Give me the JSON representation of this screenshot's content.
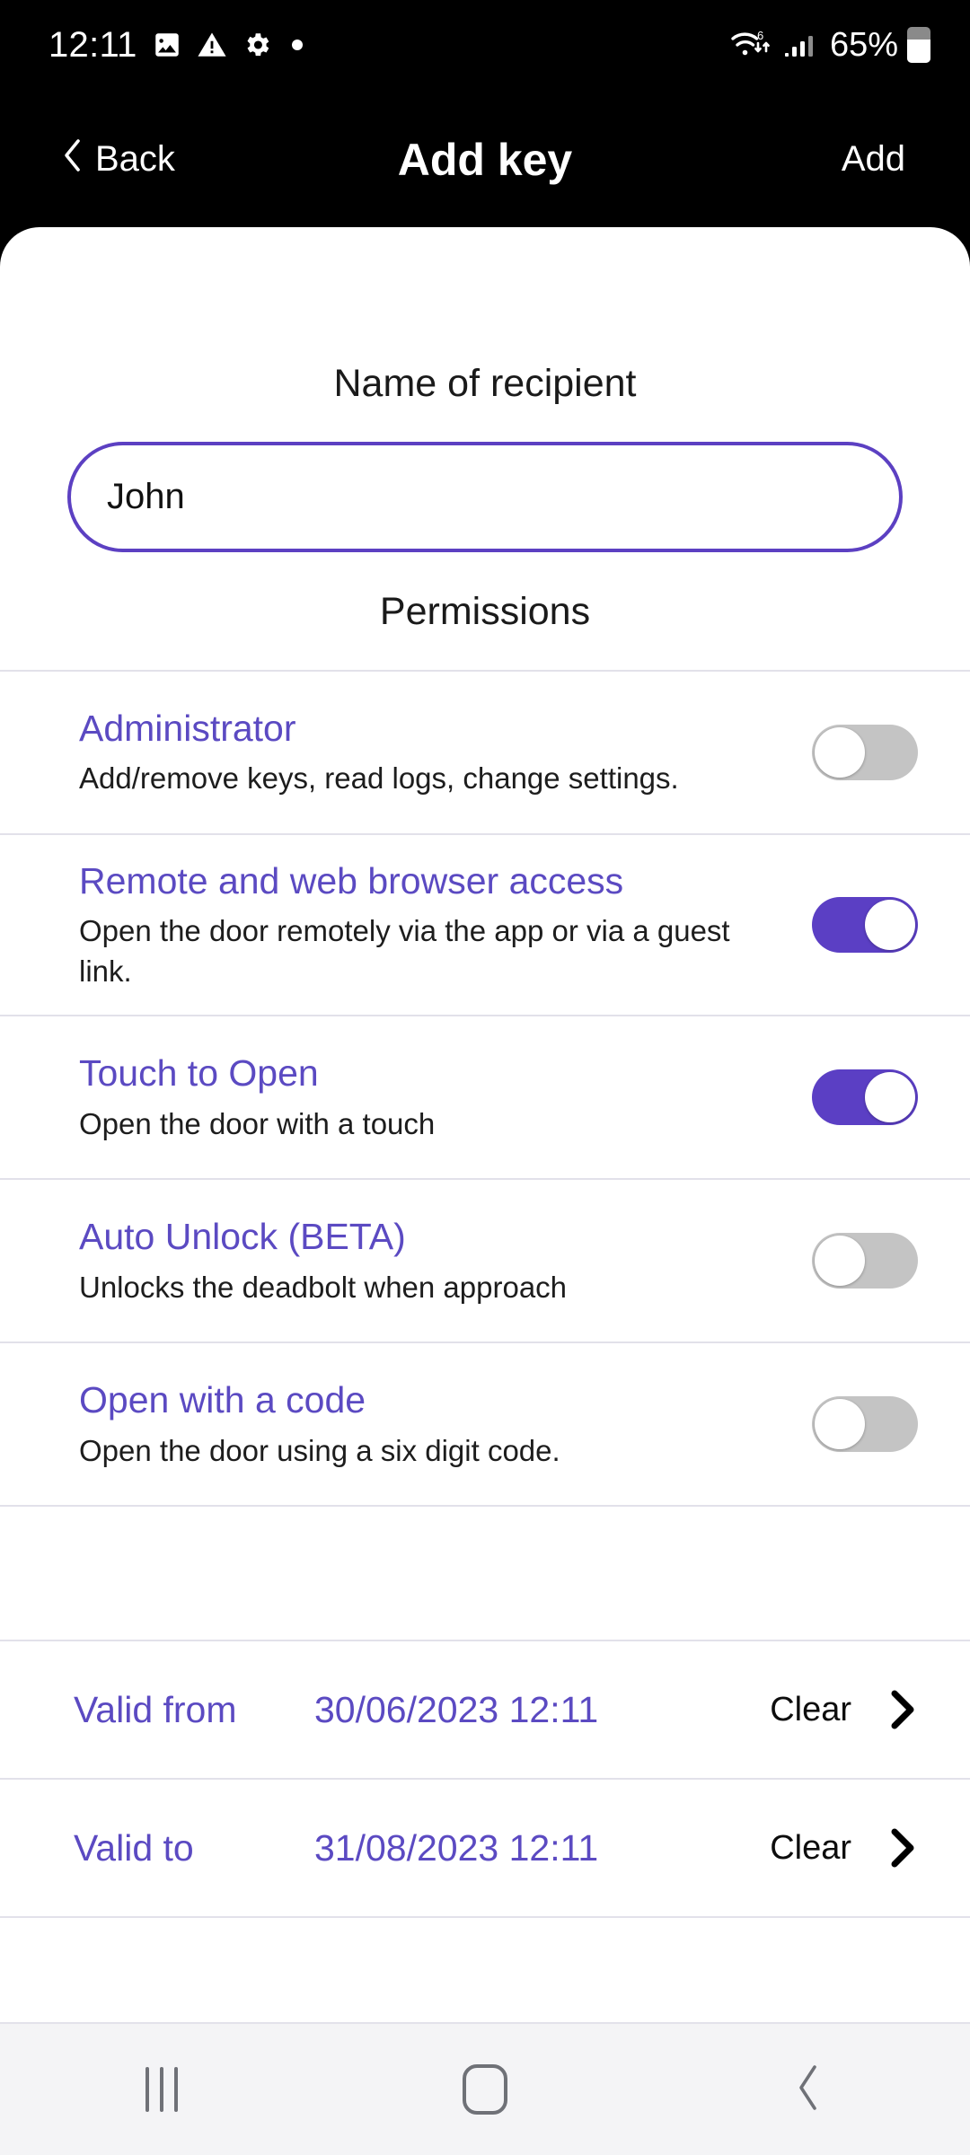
{
  "status_bar": {
    "time": "12:11",
    "icons": [
      "image-icon",
      "warning-triangle-icon",
      "gear-icon",
      "dot-icon"
    ],
    "wifi": "wifi-6-icon",
    "signal": "cellular-signal-icon",
    "battery_percent": "65%",
    "battery_icon": "battery-icon"
  },
  "header": {
    "back_label": "Back",
    "back_icon": "chevron-left-icon",
    "title": "Add key",
    "action_label": "Add"
  },
  "form": {
    "name_label": "Name of recipient",
    "name_value": "John",
    "name_placeholder": "Name of recipient",
    "permissions_label": "Permissions"
  },
  "permissions": [
    {
      "title": "Administrator",
      "desc": "Add/remove keys, read logs, change settings.",
      "enabled": false
    },
    {
      "title": "Remote and web browser access",
      "desc": "Open the door remotely via the app or via a guest link.",
      "enabled": true
    },
    {
      "title": "Touch to Open",
      "desc": "Open the door with a touch",
      "enabled": true
    },
    {
      "title": "Auto Unlock (BETA)",
      "desc": "Unlocks the deadbolt when approach",
      "enabled": false
    },
    {
      "title": "Open with a code",
      "desc": "Open the door using a six digit code.",
      "enabled": false
    }
  ],
  "validity": [
    {
      "label": "Valid from",
      "value": "30/06/2023 12:11",
      "clear_label": "Clear",
      "chevron_icon": "chevron-right-icon"
    },
    {
      "label": "Valid to",
      "value": "31/08/2023 12:11",
      "clear_label": "Clear",
      "chevron_icon": "chevron-right-icon"
    }
  ],
  "nav_bar": {
    "recents_icon": "recents-icon",
    "home_icon": "home-icon",
    "back_icon": "back-icon"
  },
  "colors": {
    "accent_purple": "#5b3fc4",
    "heading_purple": "#5b4ac2",
    "toggle_off": "#c4c4c4",
    "divider": "#e2e1ea",
    "status_bar_bg": "#000000",
    "nav_bar_bg": "#f4f4f6"
  }
}
